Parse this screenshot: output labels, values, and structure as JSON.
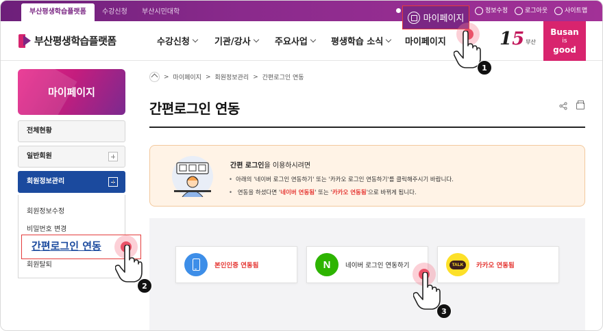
{
  "topbar": {
    "site_tabs": [
      "부산평생학습플랫폼",
      "수강신청",
      "부산시민대학"
    ],
    "links": [
      "정보수정",
      "로그아웃",
      "사이트맵"
    ],
    "mypage_label": "마이페이지"
  },
  "header": {
    "logo_text": "부산평생학습플랫폼",
    "nav": [
      "수강신청",
      "기관/강사",
      "주요사업",
      "평생학습 소식",
      "마이페이지"
    ],
    "fifteen_city": "부산",
    "busan_logo": [
      "Busan",
      "is",
      "good"
    ]
  },
  "sidebar": {
    "banner_title": "마이페이지",
    "items": [
      "전체현황",
      "일반회원",
      "회원정보관리"
    ],
    "sub_items": [
      "회원정보수정",
      "비밀번호 변경",
      "간편로그인 연동",
      "회원탈퇴"
    ]
  },
  "breadcrumb": [
    "마이페이지",
    "회원정보관리",
    "간편로그인 연동"
  ],
  "page": {
    "title": "간편로그인 연동"
  },
  "notice": {
    "title_bold": "간편 로그인",
    "title_rest": "을 이용하시려면",
    "line1": "아래의 '네이버 로그인 연동하기' 또는 '카카오 로그인 연동하기'를 클릭해주시기 바랍니다.",
    "line2_pre": "연동을 하셨다면 '",
    "line2_red1": "네이버 연동됨",
    "line2_mid": "' 또는 '",
    "line2_red2": "카카오 연동됨",
    "line2_post": "'으로 바뀌게 됩니다."
  },
  "cards": [
    {
      "label": "본인인증 연동됨",
      "icon": "phone-icon",
      "color": "#3d8ee8",
      "text_color": "#e53935"
    },
    {
      "label": "네이버 로그인 연동하기",
      "icon": "naver-icon",
      "color": "#2db400",
      "text_color": "#222222"
    },
    {
      "label": "카카오 연동됨",
      "icon": "kakao-talk-icon",
      "color": "#fde028",
      "text_color": "#e53935"
    }
  ],
  "steps": [
    "1",
    "2",
    "3"
  ],
  "colors": {
    "brand_purple": "#7b2784",
    "brand_pink": "#d8246e",
    "active_blue": "#1b4a9e",
    "highlight_red": "#e43a3a"
  }
}
